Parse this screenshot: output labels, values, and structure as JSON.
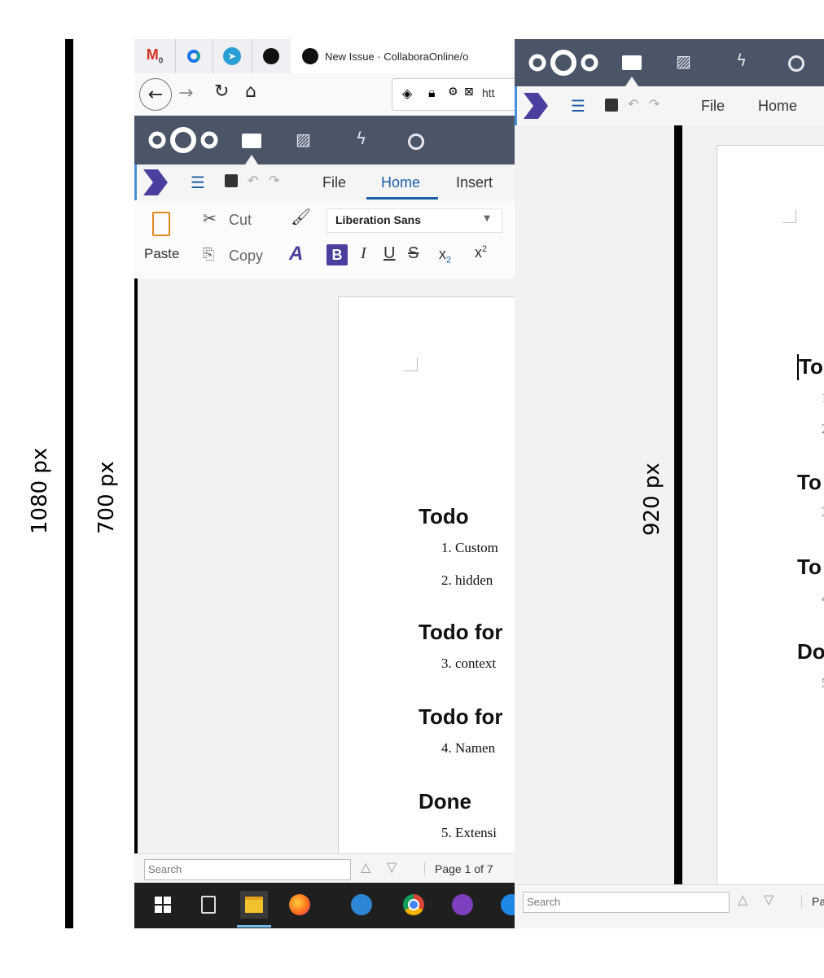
{
  "measures": {
    "outer": "1080 px",
    "left_doc": "700 px",
    "right_doc": "920 px"
  },
  "browser": {
    "tabs": [
      {
        "icon": "gmail-icon"
      },
      {
        "icon": "collabora-icon"
      },
      {
        "icon": "telegram-icon"
      },
      {
        "icon": "github-icon"
      },
      {
        "icon": "github-icon",
        "label": "New Issue · CollaboraOnline/o"
      }
    ],
    "url_prefix": "htt"
  },
  "nextcloud": {
    "apps": [
      "files-icon",
      "photos-icon",
      "activity-icon",
      "search-icon"
    ]
  },
  "office": {
    "menu": [
      "File",
      "Home",
      "Insert"
    ],
    "active_tab": "Home",
    "paste_label": "Paste",
    "cut_label": "Cut",
    "copy_label": "Copy",
    "font_name": "Liberation Sans"
  },
  "document_left": {
    "headings": [
      "Todo",
      "Todo for",
      "Todo for",
      "Done"
    ],
    "items": [
      "1.  Custom",
      "2.  hidden",
      "3.  context",
      "4.  Namen",
      "5.  Extensi"
    ]
  },
  "document_right": {
    "headings": [
      "To",
      "To",
      "To",
      "Do"
    ],
    "item_numbers": [
      "1",
      "2",
      "3",
      "4",
      "5"
    ]
  },
  "statusbar": {
    "search_placeholder": "Search",
    "page_info_left": "Page 1 of 7",
    "page_info_right": "Pa"
  },
  "taskbar": [
    "windows-start-icon",
    "task-view-icon",
    "file-explorer-icon",
    "firefox-icon",
    "mail-icon",
    "chrome-icon",
    "github-desktop-icon",
    "edge-icon"
  ],
  "colors": {
    "nextcloud_header": "#4a5568",
    "collabora_accent": "#4a3f9e",
    "active_tab_text": "#1d5fa6"
  }
}
